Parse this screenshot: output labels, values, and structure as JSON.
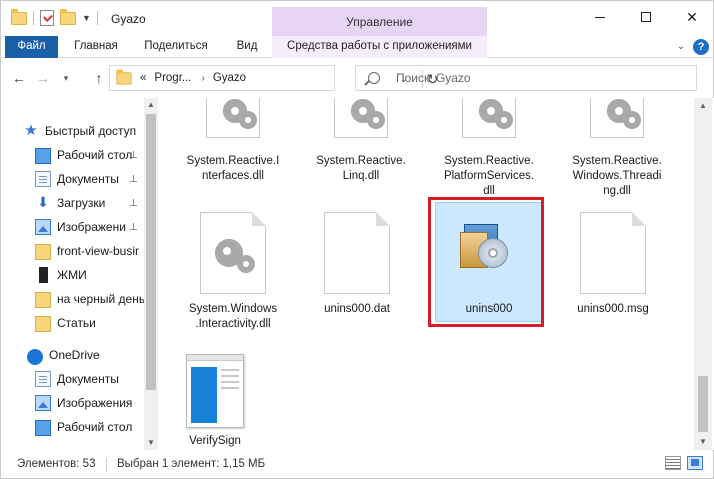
{
  "window": {
    "title": "Gyazo",
    "context_header": "Управление",
    "minimize_label": "",
    "maximize_label": "",
    "close_label": "✕"
  },
  "ribbon": {
    "tabs": [
      {
        "label": "Файл"
      },
      {
        "label": "Главная"
      },
      {
        "label": "Поделиться"
      },
      {
        "label": "Вид"
      },
      {
        "label": "Средства работы с приложениями"
      }
    ]
  },
  "address": {
    "overflow": "«",
    "crumbs": [
      "Progr...",
      "Gyazo"
    ],
    "separator": "›"
  },
  "search": {
    "placeholder": "Поиск: Gyazo"
  },
  "sidebar": {
    "items": [
      {
        "label": "Быстрый доступ",
        "icon": "star-icon"
      },
      {
        "label": "Рабочий стол",
        "icon": "desktop-icon",
        "pinned": true
      },
      {
        "label": "Документы",
        "icon": "documents-icon",
        "pinned": true
      },
      {
        "label": "Загрузки",
        "icon": "downloads-icon",
        "pinned": true
      },
      {
        "label": "Изображени",
        "icon": "pictures-icon",
        "pinned": true
      },
      {
        "label": "front-view-busir",
        "icon": "folder-icon"
      },
      {
        "label": "ЖМИ",
        "icon": "bookmark-icon"
      },
      {
        "label": "на черный день",
        "icon": "folder-icon"
      },
      {
        "label": "Статьи",
        "icon": "folder-icon"
      },
      {
        "label": "OneDrive",
        "icon": "cloud-icon"
      },
      {
        "label": "Документы",
        "icon": "documents-icon"
      },
      {
        "label": "Изображения",
        "icon": "pictures-icon"
      },
      {
        "label": "Рабочий стол",
        "icon": "desktop-icon"
      }
    ],
    "pin_glyph": "📌"
  },
  "files": [
    {
      "name": "System.Reactive.I\nnterfaces.dll",
      "icon": "dll-gear-icon"
    },
    {
      "name": "System.Reactive.\nLinq.dll",
      "icon": "dll-gear-icon"
    },
    {
      "name": "System.Reactive.\nPlatformServices.\ndll",
      "icon": "dll-gear-icon"
    },
    {
      "name": "System.Reactive.\nWindows.Threadi\nng.dll",
      "icon": "dll-gear-icon"
    },
    {
      "name": "System.Windows\n.Interactivity.dll",
      "icon": "dll-gear-icon"
    },
    {
      "name": "unins000.dat",
      "icon": "blank-file-icon"
    },
    {
      "name": "unins000",
      "icon": "setup-icon",
      "selected": true
    },
    {
      "name": "unins000.msg",
      "icon": "blank-file-icon"
    },
    {
      "name": "VerifySign",
      "icon": "app-window-icon"
    }
  ],
  "status": {
    "count": "Элементов: 53",
    "selection": "Выбран 1 элемент: 1,15 МБ"
  },
  "colors": {
    "file_tab": "#1a5fa8",
    "context_tab": "#e8d5f6",
    "selection_fill": "#cce8ff",
    "highlight_outline": "#d41f2b"
  }
}
